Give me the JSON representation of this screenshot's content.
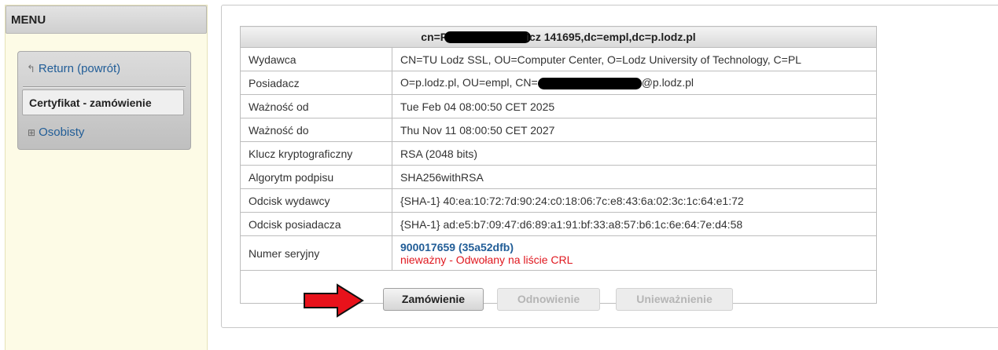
{
  "sidebar": {
    "title": "MENU",
    "return_label": "Return (powrót)",
    "active_item": "Certyfikat - zamówienie",
    "osobisty_label": "Osobisty"
  },
  "certificate": {
    "header_prefix": "cn=P",
    "header_suffix": "icz 141695,dc=empl,dc=p.lodz.pl",
    "rows": [
      {
        "label": "Wydawca",
        "value": "CN=TU Lodz SSL, OU=Computer Center, O=Lodz University of Technology, C=PL"
      },
      {
        "label": "Posiadacz",
        "value_prefix": "O=p.lodz.pl, OU=empl, CN=",
        "value_suffix": "@p.lodz.pl"
      },
      {
        "label": "Ważność od",
        "value": "Tue Feb 04 08:00:50 CET 2025"
      },
      {
        "label": "Ważność do",
        "value": "Thu Nov 11 08:00:50 CET 2027"
      },
      {
        "label": "Klucz kryptograficzny",
        "value": "RSA (2048 bits)"
      },
      {
        "label": "Algorytm podpisu",
        "value": "SHA256withRSA"
      },
      {
        "label": "Odcisk wydawcy",
        "value": "{SHA-1} 40:ea:10:72:7d:90:24:c0:18:06:7c:e8:43:6a:02:3c:1c:64:e1:72"
      },
      {
        "label": "Odcisk posiadacza",
        "value": "{SHA-1} ad:e5:b7:09:47:d6:89:a1:91:bf:33:a8:57:b6:1c:6e:64:7e:d4:58"
      }
    ],
    "serial": {
      "label": "Numer seryjny",
      "number": "900017659 (35a52dfb)",
      "status": "nieważny - Odwołany na liście CRL"
    }
  },
  "actions": {
    "order": "Zamówienie",
    "renew": "Odnowienie",
    "revoke": "Unieważnienie"
  },
  "colors": {
    "link": "#215d97",
    "status_error": "#e0181f",
    "arrow": "#e8121b",
    "sidebar_bg": "#fdfbe6"
  }
}
